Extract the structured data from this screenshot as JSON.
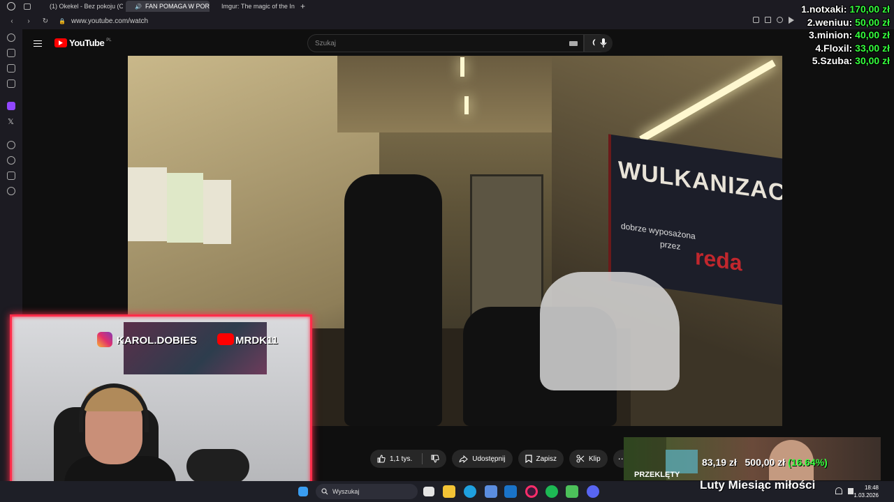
{
  "browser": {
    "tabs": [
      {
        "label": "(1) Okekel - Bez pokoju (O",
        "active": false,
        "favicon_color": "#ff0000"
      },
      {
        "label": "FAN POMAGA W POR",
        "active": true,
        "favicon_color": "#ff0000"
      },
      {
        "label": "Imgur: The magic of the In",
        "active": false,
        "favicon_color": "#1bb76e"
      }
    ],
    "new_tab_label": "+",
    "url": "www.youtube.com/watch"
  },
  "youtube": {
    "logo_text": "YouTube",
    "region": "PL",
    "search_placeholder": "Szukaj"
  },
  "video": {
    "banner_main": "WULKANIZAC",
    "banner_sub_1": "dobrze wyposażona",
    "banner_sub_2": "przez",
    "banner_brand": "redа"
  },
  "webcam": {
    "instagram_handle": "KAROL.DOBIES",
    "youtube_handle": "MRDK11"
  },
  "actions": {
    "like_count": "1,1 tys.",
    "share_label": "Udostępnij",
    "save_label": "Zapisz",
    "clip_label": "Klip",
    "more_label": "⋯"
  },
  "donations": [
    {
      "rank": "1.",
      "name": "notxaki:",
      "amount": "170,00 zł"
    },
    {
      "rank": "2.",
      "name": "weniuu:",
      "amount": "50,00 zł"
    },
    {
      "rank": "3.",
      "name": "minion:",
      "amount": "40,00 zł"
    },
    {
      "rank": "4.",
      "name": "Floxil:",
      "amount": "33,00 zł"
    },
    {
      "rank": "5.",
      "name": "Szuba:",
      "amount": "30,00 zł"
    }
  ],
  "goal": {
    "current": "83,19 zł",
    "target": "500,00 zł",
    "percent_text": "(16.64%)",
    "progress": 0.1664,
    "title": "Luty Miesiąc miłości",
    "logo_text": "PRZEKLĘTY"
  },
  "taskbar": {
    "search_label": "Wyszukaj",
    "time": "18:48",
    "date": "1.03.2026"
  },
  "colors": {
    "accent_green": "#35ff3d",
    "webcam_border": "#ff2d4a",
    "youtube_red": "#ff0000"
  }
}
